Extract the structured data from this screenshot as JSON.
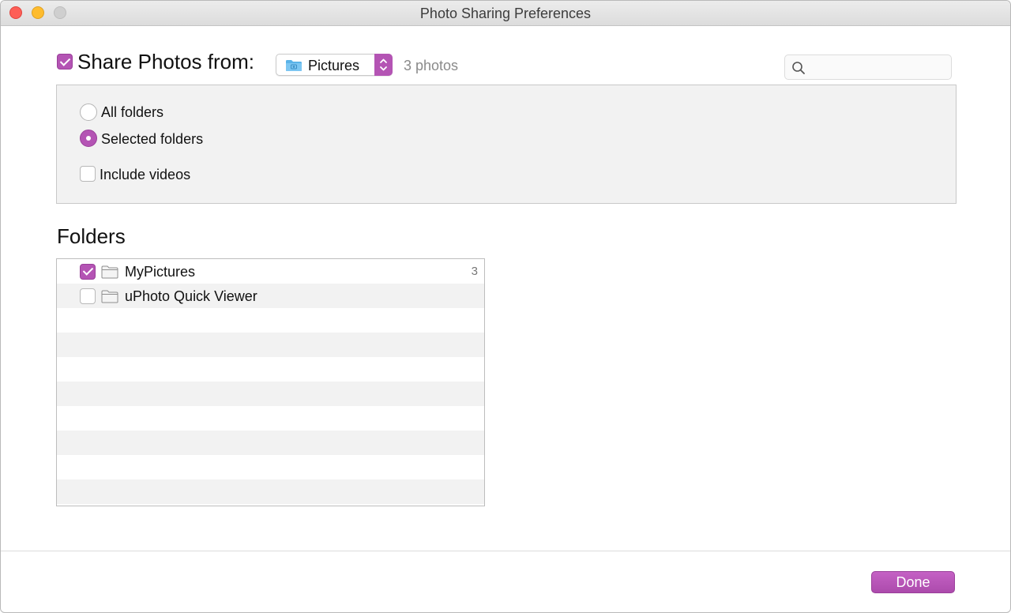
{
  "window": {
    "title": "Photo Sharing Preferences"
  },
  "share": {
    "label": "Share Photos from:",
    "checked": true,
    "source": "Pictures",
    "count_text": "3 photos"
  },
  "search": {
    "placeholder": "",
    "value": ""
  },
  "options": {
    "all_folders": "All folders",
    "selected_folders": "Selected folders",
    "include_videos": "Include videos",
    "selected": "selected_folders",
    "include_videos_checked": false
  },
  "folders": {
    "heading": "Folders",
    "items": [
      {
        "name": "MyPictures",
        "checked": true,
        "count": "3"
      },
      {
        "name": "uPhoto Quick Viewer",
        "checked": false,
        "count": ""
      }
    ]
  },
  "footer": {
    "done_label": "Done"
  },
  "colors": {
    "accent": "#b454b4",
    "folder": "#9e9e9e",
    "popup_folder": "#5ab3e8"
  }
}
